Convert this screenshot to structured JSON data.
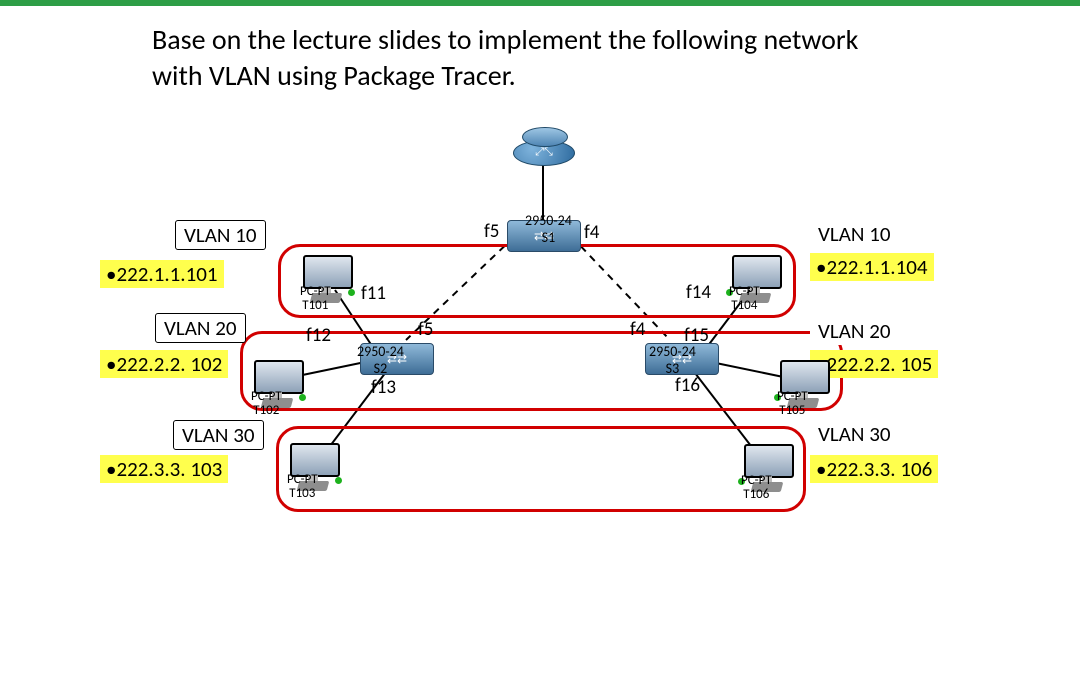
{
  "instruction": "Base on the lecture slides to implement the following network with VLAN using Package Tracer.",
  "left": {
    "v10": {
      "title": "VLAN 10",
      "ip": "•222.1.1.101"
    },
    "v20": {
      "title": "VLAN 20",
      "ip": "•222.2.2. 102"
    },
    "v30": {
      "title": "VLAN 30",
      "ip": "•222.3.3. 103"
    }
  },
  "right": {
    "v10": {
      "title": "VLAN 10",
      "ip": "•222.1.1.104"
    },
    "v20": {
      "title": "VLAN 20",
      "ip": "•222.2.2. 105"
    },
    "v30": {
      "title": "VLAN 30",
      "ip": "•222.3.3. 106"
    }
  },
  "pcs": {
    "t101": "PC-PT\nT101",
    "t102": "PC-PT\nT102",
    "t103": "PC-PT\nT103",
    "t104": "PC-PT\nT104",
    "t105": "PC-PT\nT105",
    "t106": "PC-PT\nT106"
  },
  "switches": {
    "s1": "2950-24\nS1",
    "s2": "2950-24\nS2",
    "s3": "2950-24\nS3"
  },
  "ports": {
    "s1_left": "f5",
    "s1_right": "f4",
    "s2_up": "f5",
    "s3_up": "f4",
    "s2_p11": "f11",
    "s2_p12": "f12",
    "s2_p13": "f13",
    "s3_p14": "f14",
    "s3_p15": "f15",
    "s3_p16": "f16"
  }
}
